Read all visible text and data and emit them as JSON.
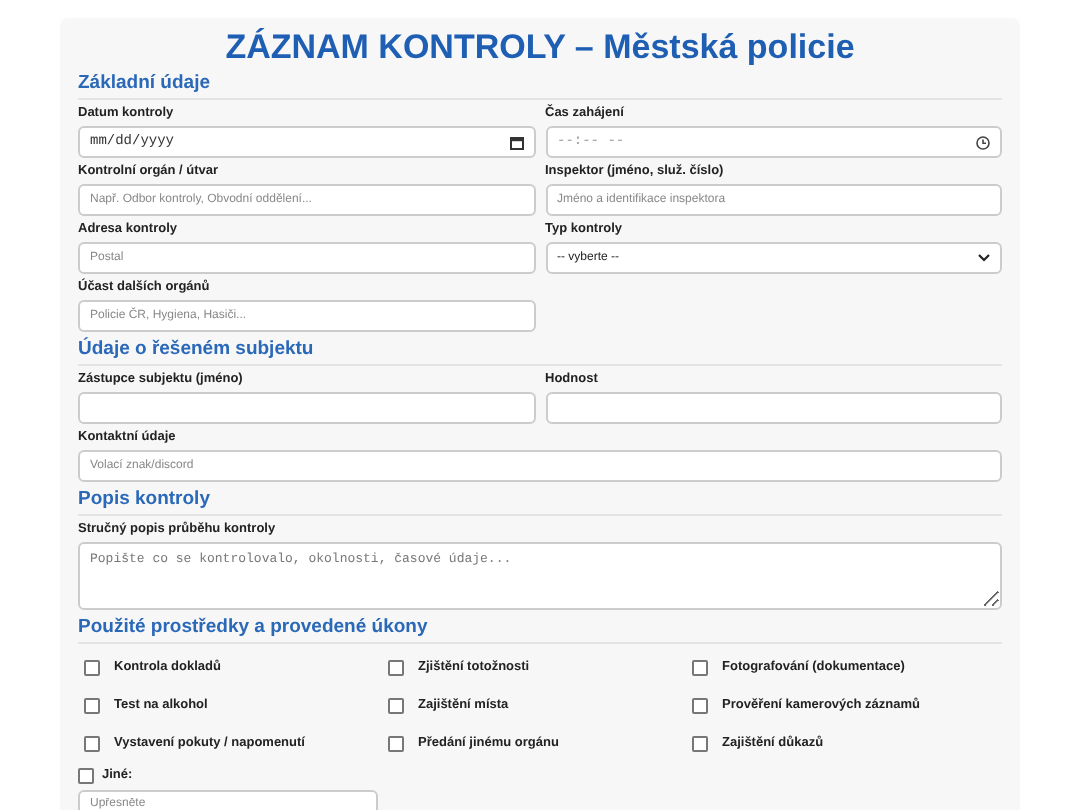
{
  "title": "ZÁZNAM KONTROLY – Městská policie",
  "sections": [
    {
      "heading": "Základní údaje",
      "fields": [
        {
          "label": "Datum kontroly",
          "kind": "date",
          "placeholder": "mm/dd/yyyy",
          "wide": false
        },
        {
          "label": "Čas zahájení",
          "kind": "time",
          "placeholder": "--:-- --",
          "wide": false
        },
        {
          "label": "Kontrolní orgán / útvar",
          "kind": "text",
          "placeholder": "Např. Odbor kontroly, Obvodní oddělení...",
          "wide": false
        },
        {
          "label": "Inspektor (jméno, služ. číslo)",
          "kind": "text",
          "placeholder": "Jméno a identifikace inspektora",
          "wide": false
        },
        {
          "label": "Adresa kontroly",
          "kind": "text",
          "placeholder": "Postal",
          "wide": false
        },
        {
          "label": "Typ kontroly",
          "kind": "select",
          "value": "-- vyberte --",
          "wide": false
        },
        {
          "label": "Účast dalších orgánů",
          "kind": "text",
          "placeholder": "Policie ČR, Hygiena, Hasiči...",
          "wide": false
        }
      ]
    },
    {
      "heading": "Údaje o řešeném subjektu",
      "fields": [
        {
          "label": "Zástupce subjektu (jméno)",
          "kind": "text",
          "wide": false
        },
        {
          "label": "Hodnost",
          "kind": "text",
          "wide": false
        },
        {
          "label": "Kontaktní údaje",
          "kind": "text",
          "placeholder": "Volací znak/discord",
          "wide": true
        }
      ]
    },
    {
      "heading": "Popis kontroly",
      "fields": [
        {
          "label": "Stručný popis průběhu kontroly",
          "kind": "textarea",
          "placeholder": "Popište co se kontrolovalo, okolnosti, časové údaje...",
          "wide": true
        }
      ]
    },
    {
      "heading": "Použité prostředky a provedené úkony",
      "checks": [
        {
          "label": "Kontrola dokladů",
          "checked": false
        },
        {
          "label": "Zjištění totožnosti",
          "checked": false
        },
        {
          "label": "Fotografování (dokumentace)",
          "checked": false
        },
        {
          "label": "Test na alkohol",
          "checked": false
        },
        {
          "label": "Zajištění místa",
          "checked": false
        },
        {
          "label": "Prověření kamerových záznamů",
          "checked": false
        },
        {
          "label": "Vystavení pokuty / napomenutí",
          "checked": false
        },
        {
          "label": "Předání jinému orgánu",
          "checked": false
        },
        {
          "label": "Zajištění důkazů",
          "checked": false
        }
      ],
      "other": {
        "label": "Jiné:",
        "checked": false,
        "placeholder": "Upřesněte"
      }
    }
  ]
}
